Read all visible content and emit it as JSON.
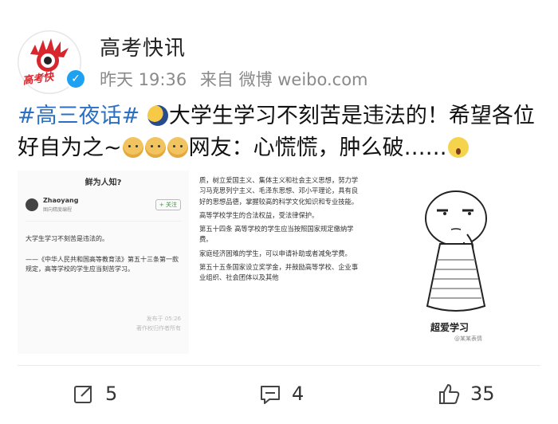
{
  "header": {
    "username": "高考快讯",
    "avatar_logo_text": "高考快",
    "meta_time": "昨天 19:36",
    "meta_source": "来自 微博 weibo.com"
  },
  "post": {
    "hashtag": "#高三夜话#",
    "text_part1": "大学生学习不刻苦是违法的！希望各位好自为之~",
    "text_part2": "网友：心慌慌，肿么破……"
  },
  "images": {
    "card1": {
      "title": "鲜为人知?",
      "author_name": "Zhaoyang",
      "author_role": "图向精度编程",
      "follow_label": "+ 关注",
      "body_line1": "大学生学习不刻苦是违法的。",
      "body_line2": "——《中华人民共和国高等教育法》第五十三条第一款规定，高等学校的学生应当刻苦学习。",
      "published": "发布于 05:26",
      "copyright": "著作权归作者所有"
    },
    "card2": {
      "para1": "质，树立爱国主义、集体主义和社会主义思想，努力学习马克思列宁主义、毛泽东思想、邓小平理论，具有良好的思想品德，掌握较高的科学文化知识和专业技能。",
      "para2": "高等学校学生的合法权益，受法律保护。",
      "para3": "第五十四条 高等学校的学生应当按照国家规定缴纳学费。",
      "para4": "家庭经济困难的学生，可以申请补助或者减免学费。",
      "para5": "第五十五条国家设立奖学金，并鼓励高等学校、企业事业组织、社会团体以及其他"
    },
    "card3": {
      "caption": "超爱学习",
      "watermark": "@某某表情"
    }
  },
  "actions": {
    "repost_count": "5",
    "comment_count": "4",
    "like_count": "35"
  },
  "colors": {
    "hashtag": "#2b6fc2",
    "verify_badge": "#1ea1f1",
    "meta_gray": "#8a8a8a"
  }
}
